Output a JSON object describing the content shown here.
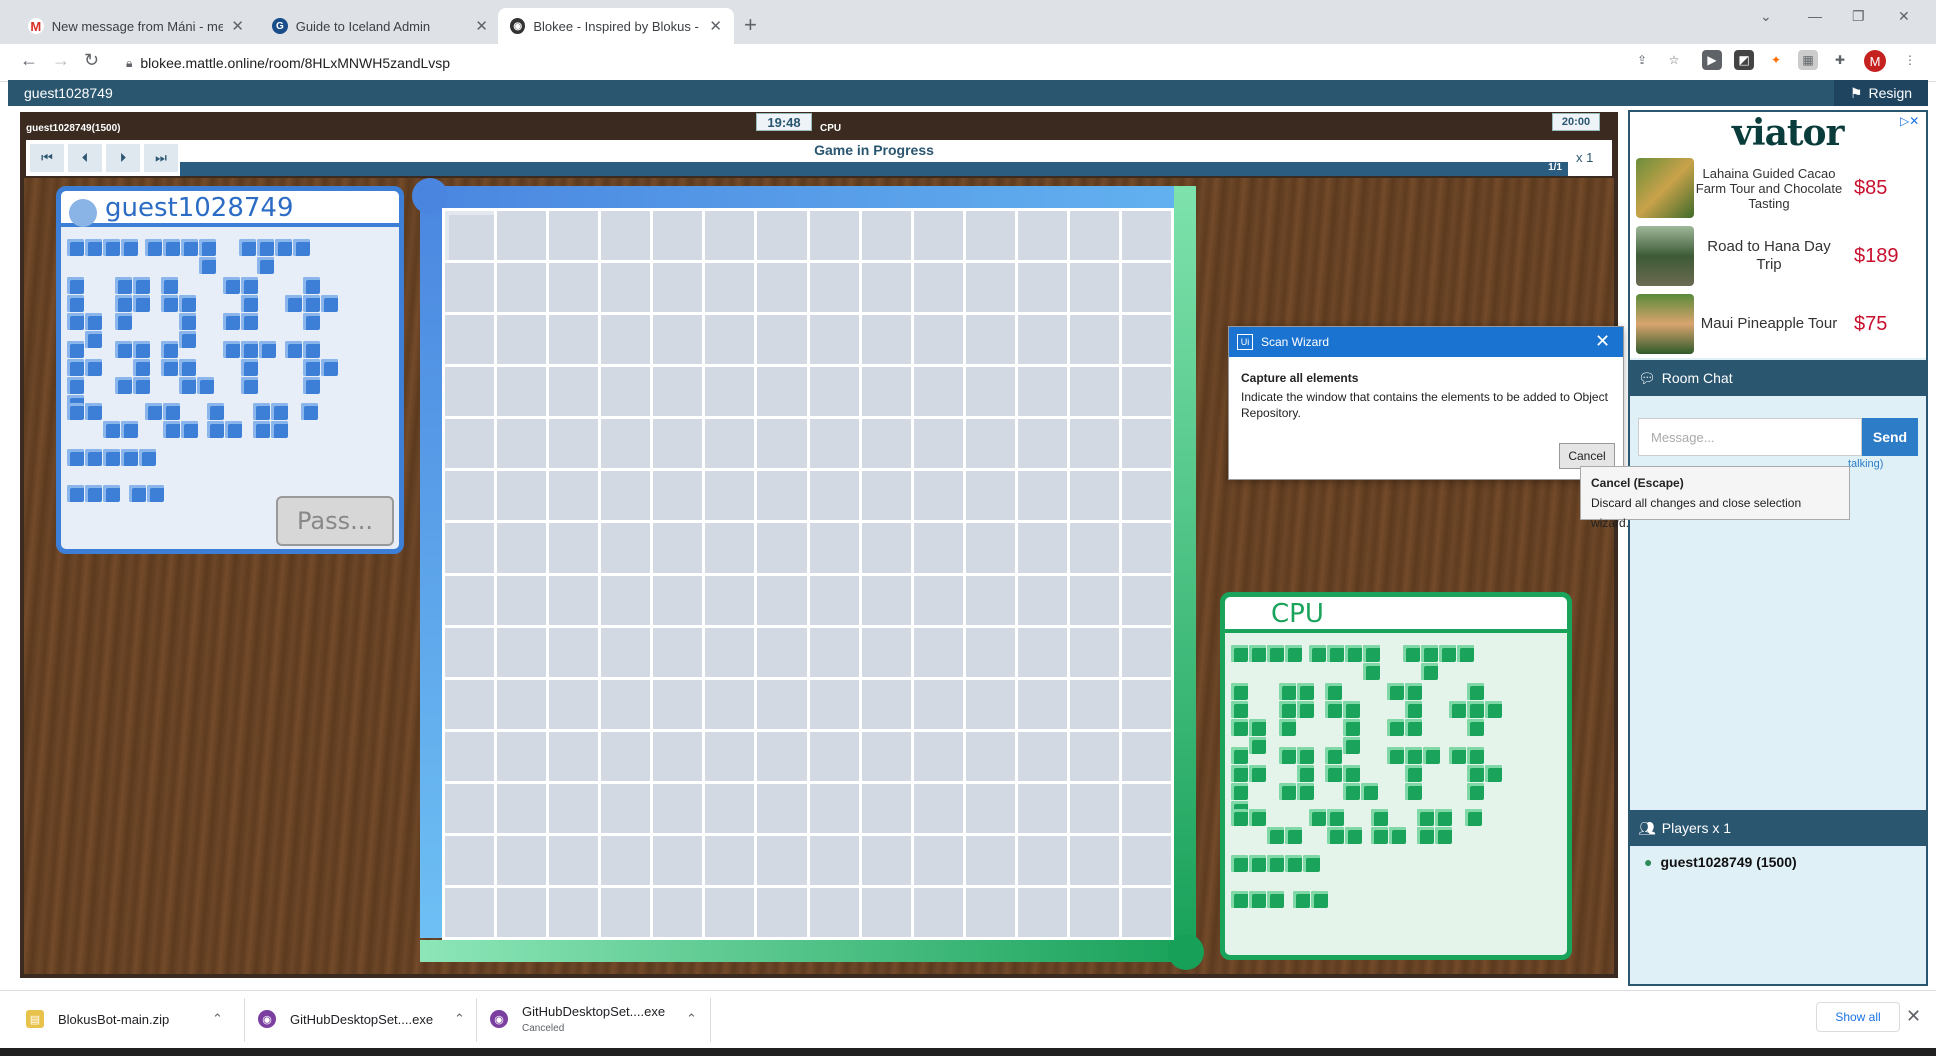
{
  "browser": {
    "tabs": [
      {
        "title": "New message from Máni - melo",
        "icon": "gmail-icon",
        "active": false
      },
      {
        "title": "Guide to Iceland Admin",
        "icon": "g-icon",
        "active": false
      },
      {
        "title": "Blokee - Inspired by Blokus - Onl",
        "icon": "blokee-icon",
        "active": true
      }
    ],
    "url": "blokee.mattle.online/room/8HLxMNWH5zandLvsp",
    "profile_initial": "M"
  },
  "site": {
    "username": "guest1028749",
    "resign_label": "Resign"
  },
  "game": {
    "player_label": "guest1028749(1500)",
    "opponent_label": "CPU",
    "player_clock": "19:48",
    "opponent_clock": "20:00",
    "status": "Game in Progress",
    "move_counter": "1/1",
    "speed": "x 1",
    "pass_label": "Pass...",
    "blue_panel_name": "guest1028749",
    "green_panel_name": "CPU",
    "board_size": 14,
    "colors": {
      "blue": "#3d7fd6",
      "green": "#1aa35a",
      "header": "#2b5670"
    }
  },
  "wizard": {
    "title": "Scan Wizard",
    "heading": "Capture all elements",
    "body": "Indicate the window that contains the elements to be added to Object Repository.",
    "cancel_label": "Cancel",
    "tooltip_title": "Cancel (Escape)",
    "tooltip_body": "Discard all changes and close selection wizard."
  },
  "sidebar": {
    "ad_brand": "viator",
    "ads": [
      {
        "name": "Lahaina Guided Cacao Farm Tour and Chocolate Tasting",
        "price": "$85"
      },
      {
        "name": "Road to Hana Day Trip",
        "price": "$189"
      },
      {
        "name": "Maui Pineapple Tour",
        "price": "$75"
      }
    ],
    "chat_title": "Room Chat",
    "message_placeholder": "Message...",
    "send_label": "Send",
    "talk_hint": "talking)",
    "players_title": "Players x 1",
    "player_entry": "guest1028749 (1500)"
  },
  "downloads": {
    "items": [
      {
        "name": "BlokusBot-main.zip",
        "status": ""
      },
      {
        "name": "GitHubDesktopSet....exe",
        "status": ""
      },
      {
        "name": "GitHubDesktopSet....exe",
        "status": "Canceled"
      }
    ],
    "show_all_label": "Show all"
  }
}
